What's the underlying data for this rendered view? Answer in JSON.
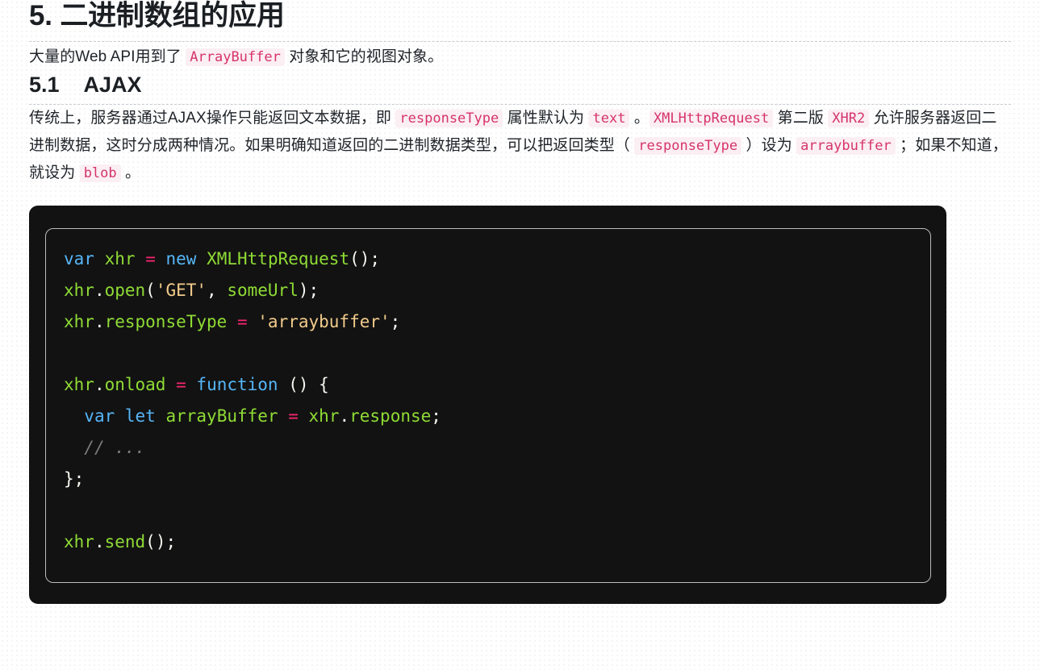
{
  "document": {
    "heading_main": "5. 二进制数组的应用",
    "intro_paragraph": {
      "seg1": "大量的Web API用到了 ",
      "code1": "ArrayBuffer",
      "seg2": " 对象和它的视图对象。"
    },
    "heading_sub": {
      "number": "5.1",
      "title": "AJAX"
    },
    "body_paragraph": {
      "seg1": "传统上，服务器通过AJAX操作只能返回文本数据，即 ",
      "code1": "responseType",
      "seg2": " 属性默认为 ",
      "code2": "text",
      "seg3": " 。",
      "code3": "XMLHttpRequest",
      "seg4": " 第二版 ",
      "code4": "XHR2",
      "seg5": " 允许服务器返回二进制数据，这时分成两种情况。如果明确知道返回的二进制数据类型，可以把返回类型（ ",
      "code5": "responseType",
      "seg6": " ）设为 ",
      "code6": "arraybuffer",
      "seg7": " ；如果不知道，就设为 ",
      "code7": "blob",
      "seg8": " 。"
    },
    "code_block": {
      "language": "javascript",
      "lines": [
        "var xhr = new XMLHttpRequest();",
        "xhr.open('GET', someUrl);",
        "xhr.responseType = 'arraybuffer';",
        "",
        "xhr.onload = function () {",
        "  var let arrayBuffer = xhr.response;",
        "  // ...",
        "};",
        "",
        "xhr.send();"
      ]
    }
  },
  "theme": {
    "page_background": "#ffffff",
    "dot_grid_color": "#ededed",
    "heading_color": "#1b1f23",
    "text_color": "#1f2328",
    "inline_code_color": "#d6336c",
    "inline_code_background": "#fbeff3",
    "rule_color": "#c9ccd1",
    "code_block_background": "#121212",
    "code_inner_border": "#b9bcc0",
    "token_keyword": "#56b6f7",
    "token_variable": "#8fdc35",
    "token_operator": "#f92672",
    "token_string": "#f2cb8b",
    "token_punctuation": "#f8f8f2",
    "token_comment": "#7d7d7d"
  }
}
